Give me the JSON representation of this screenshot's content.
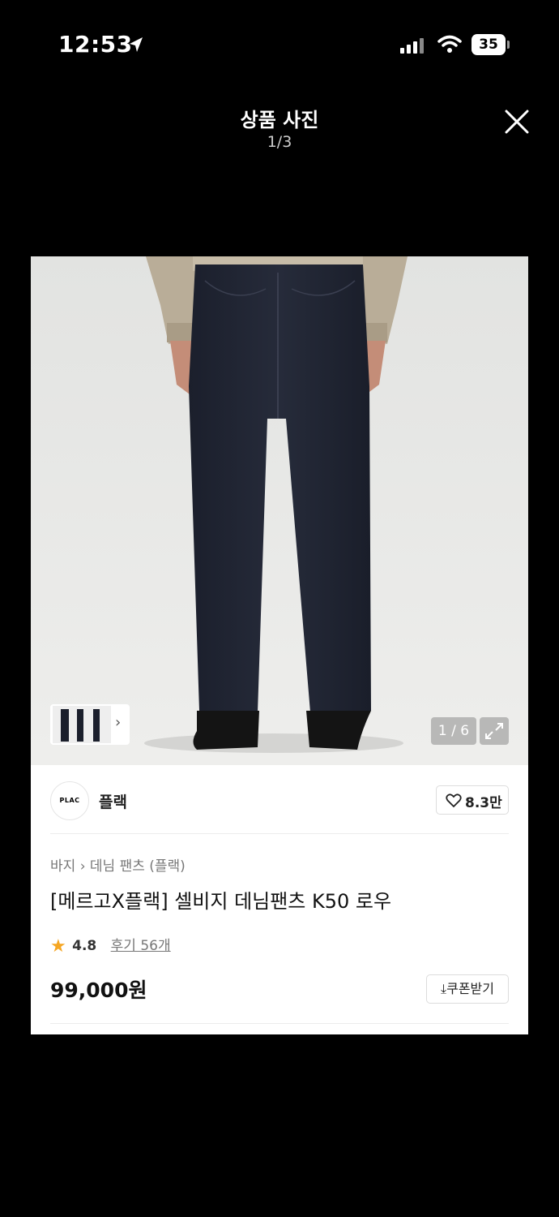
{
  "status_bar": {
    "time": "12:53",
    "battery": "35"
  },
  "header": {
    "title": "상품 사진",
    "counter": "1/3"
  },
  "photo": {
    "page_indicator": "1 / 6"
  },
  "product": {
    "brand": {
      "logo_text": "PLAC",
      "name": "플랙",
      "likes": "8.3만"
    },
    "breadcrumb": [
      "바지",
      "데님 팬츠 (플랙)"
    ],
    "title": "[메르고X플랙] 셀비지 데님팬츠 K50 로우",
    "rating": "4.8",
    "reviews": "후기 56개",
    "price": "99,000원",
    "coupon_label": "쿠폰받기"
  },
  "colors": {
    "accent_star": "#f5a623",
    "background": "#000000"
  }
}
